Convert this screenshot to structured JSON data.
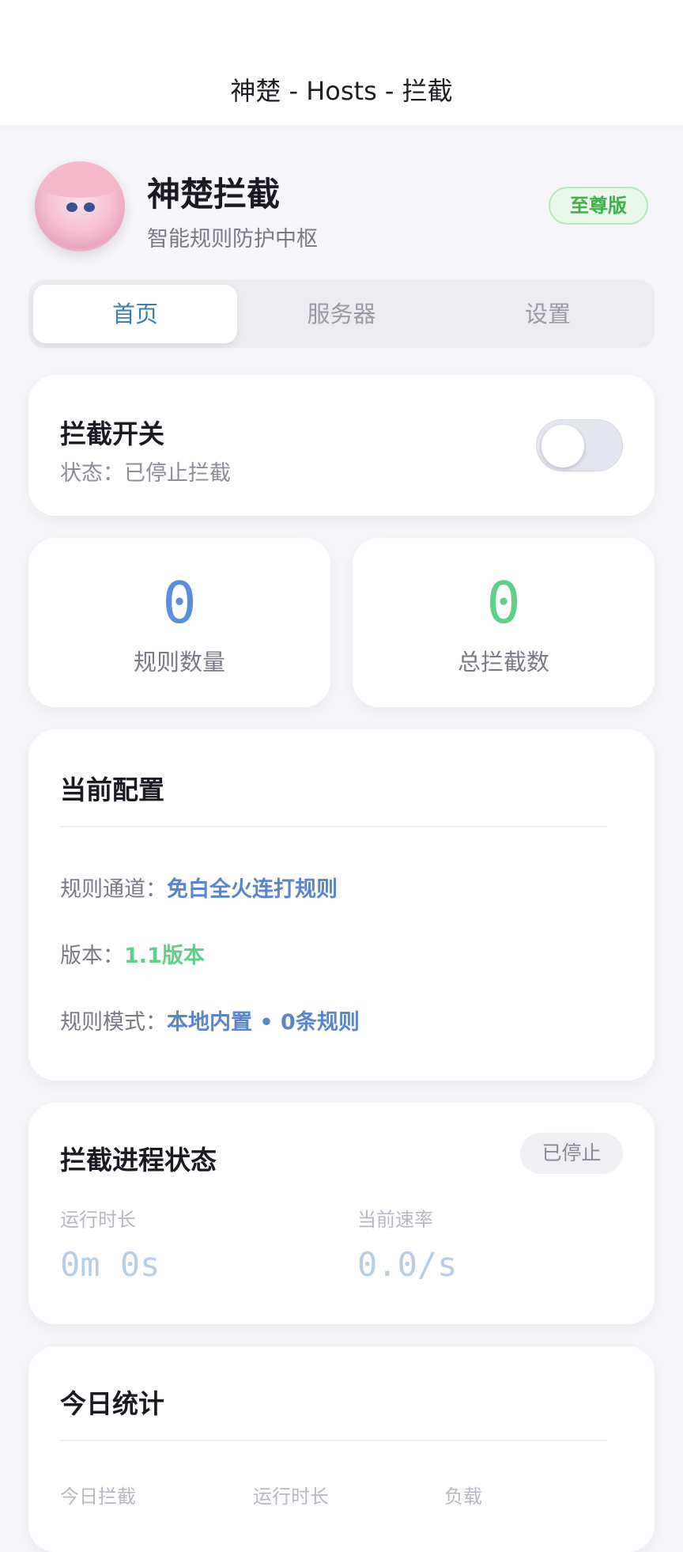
{
  "topbar": {
    "title": "神楚 - Hosts - 拦截"
  },
  "profile": {
    "name": "神楚拦截",
    "subtitle": "智能规则防护中枢",
    "badge": "至尊版"
  },
  "tabs": [
    {
      "label": "首页",
      "active": true
    },
    {
      "label": "服务器",
      "active": false
    },
    {
      "label": "设置",
      "active": false
    }
  ],
  "switch_card": {
    "title": "拦截开关",
    "status": "状态：已停止拦截",
    "toggle_on": false
  },
  "stats": [
    {
      "value": "0",
      "label": "规则数量",
      "color": "#5b8fdc"
    },
    {
      "value": "0",
      "label": "总拦截数",
      "color": "#5fcf8a"
    }
  ],
  "config": {
    "title": "当前配置",
    "rows": [
      {
        "key": "规则通道：",
        "value": "免白全火连打规则",
        "color": "#5a86c8"
      },
      {
        "key": "版本：",
        "value": "1.1版本",
        "color": "#5fcf8a"
      },
      {
        "key": "规则模式：",
        "value": "本地内置 • 0条规则",
        "color": "#5a86c8"
      }
    ]
  },
  "process": {
    "title": "拦截进程状态",
    "status_chip": "已停止",
    "runtime_label": "运行时长",
    "runtime_value": "0m 0s",
    "rate_label": "当前速率",
    "rate_value": "0.0/s"
  },
  "today": {
    "title": "今日统计",
    "labels": [
      "今日拦截",
      "运行时长",
      "负载"
    ]
  }
}
